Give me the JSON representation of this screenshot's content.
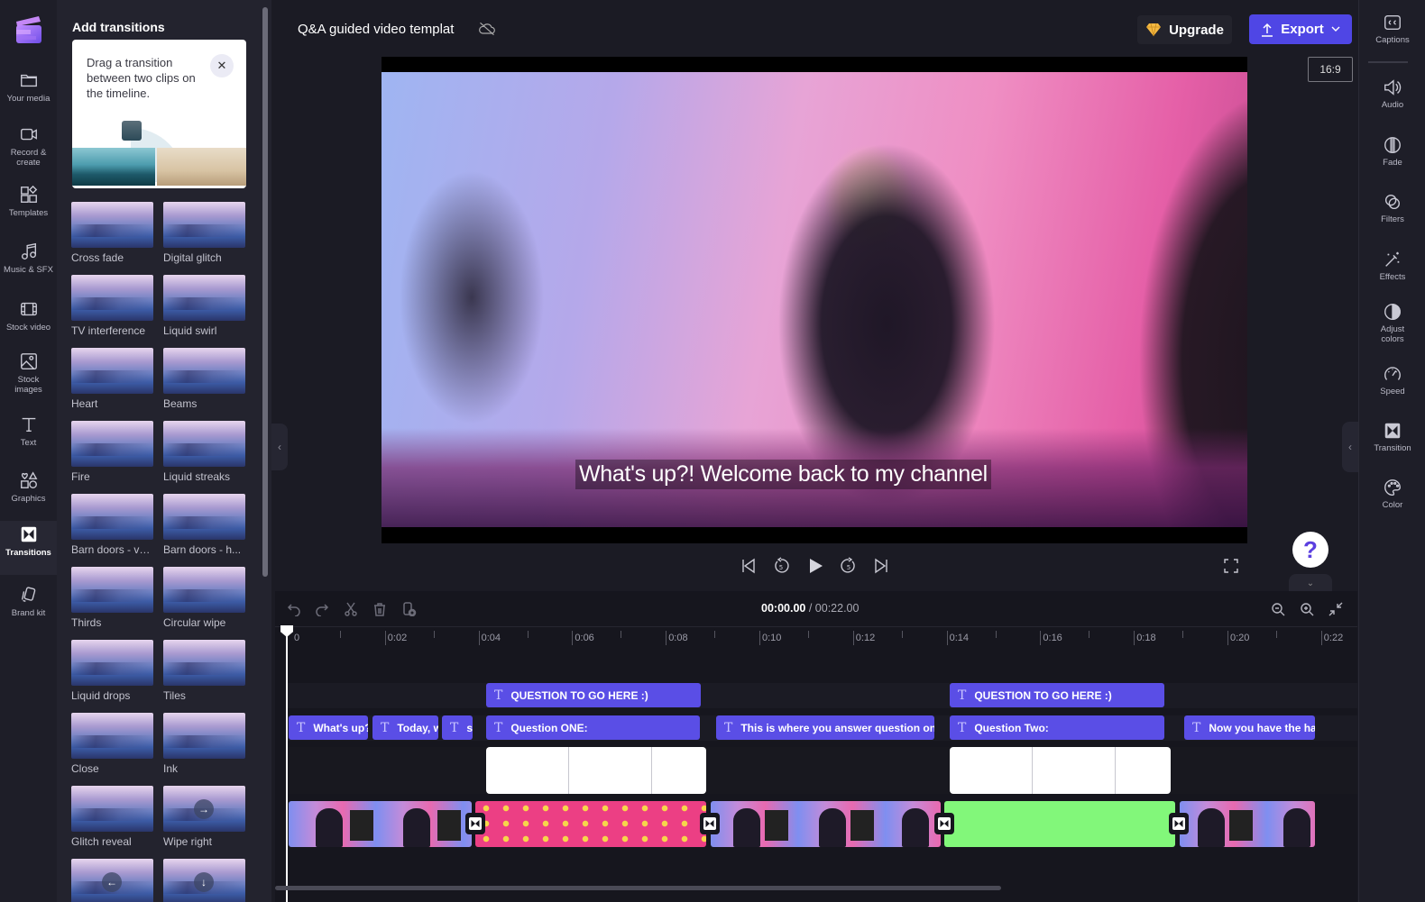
{
  "app": {
    "project_title": "Q&A guided video templat",
    "cloud_status_icon": "cloud-off-icon",
    "upgrade_label": "Upgrade",
    "export_label": "Export",
    "aspect_ratio": "16:9",
    "accent_color": "#4f46e5",
    "upgrade_icon_color": "#f5b942"
  },
  "left_rail": {
    "items": [
      {
        "id": "your-media",
        "label": "Your media",
        "icon": "folder-icon"
      },
      {
        "id": "record-create",
        "label": "Record & create",
        "icon": "video-camera-icon"
      },
      {
        "id": "templates",
        "label": "Templates",
        "icon": "templates-icon"
      },
      {
        "id": "music-sfx",
        "label": "Music & SFX",
        "icon": "music-note-icon"
      },
      {
        "id": "stock-video",
        "label": "Stock video",
        "icon": "film-icon"
      },
      {
        "id": "stock-images",
        "label": "Stock images",
        "icon": "image-icon"
      },
      {
        "id": "text",
        "label": "Text",
        "icon": "text-icon"
      },
      {
        "id": "graphics",
        "label": "Graphics",
        "icon": "shapes-icon"
      },
      {
        "id": "transitions",
        "label": "Transitions",
        "icon": "transition-icon",
        "active": true
      },
      {
        "id": "brand-kit",
        "label": "Brand kit",
        "icon": "brand-kit-icon"
      }
    ]
  },
  "transitions_panel": {
    "title": "Add transitions",
    "tip_text": "Drag a transition between two clips on the timeline.",
    "items": [
      {
        "name": "Cross fade"
      },
      {
        "name": "Digital glitch"
      },
      {
        "name": "TV interference"
      },
      {
        "name": "Liquid swirl"
      },
      {
        "name": "Heart"
      },
      {
        "name": "Beams"
      },
      {
        "name": "Fire"
      },
      {
        "name": "Liquid streaks"
      },
      {
        "name": "Barn doors - ve..."
      },
      {
        "name": "Barn doors - h..."
      },
      {
        "name": "Thirds"
      },
      {
        "name": "Circular wipe"
      },
      {
        "name": "Liquid drops"
      },
      {
        "name": "Tiles"
      },
      {
        "name": "Close"
      },
      {
        "name": "Ink"
      },
      {
        "name": "Glitch reveal"
      },
      {
        "name": "Wipe right",
        "arrow": "→"
      },
      {
        "name": "",
        "arrow": "←"
      },
      {
        "name": "",
        "arrow": "↓"
      }
    ]
  },
  "preview": {
    "caption": "What's up?! Welcome back to my channel"
  },
  "player": {
    "current_time": "00:00.00",
    "total_time": "/ 00:22.00",
    "skip_back_seconds": "5",
    "skip_forward_seconds": "5"
  },
  "right_rail": {
    "items": [
      {
        "id": "captions",
        "label": "Captions",
        "icon": "captions-icon"
      },
      {
        "id": "audio",
        "label": "Audio",
        "icon": "speaker-icon"
      },
      {
        "id": "fade",
        "label": "Fade",
        "icon": "fade-icon"
      },
      {
        "id": "filters",
        "label": "Filters",
        "icon": "filters-icon"
      },
      {
        "id": "effects",
        "label": "Effects",
        "icon": "magic-wand-icon"
      },
      {
        "id": "adjust-colors",
        "label": "Adjust colors",
        "icon": "contrast-icon"
      },
      {
        "id": "speed",
        "label": "Speed",
        "icon": "speedometer-icon"
      },
      {
        "id": "transition",
        "label": "Transition",
        "icon": "transition-icon"
      },
      {
        "id": "color",
        "label": "Color",
        "icon": "palette-icon"
      }
    ]
  },
  "timeline": {
    "ruler_labels": [
      "0",
      "0:02",
      "0:04",
      "0:06",
      "0:08",
      "0:10",
      "0:12",
      "0:14",
      "0:16",
      "0:18",
      "0:20",
      "0:22"
    ],
    "text_track_1": [
      {
        "label": "QUESTION TO GO HERE :)"
      },
      {
        "label": "QUESTION TO GO HERE :)"
      }
    ],
    "text_track_2": [
      {
        "label": "What's up?"
      },
      {
        "label": "Today, w"
      },
      {
        "label": "s"
      },
      {
        "label": "Question ONE:"
      },
      {
        "label": "This is where you answer question one"
      },
      {
        "label": "Question Two:"
      },
      {
        "label": "Now you have the ha"
      }
    ],
    "clip_colors": {
      "text_clip": "#5a4ee6",
      "pink_background": "#ec3f84",
      "green_background": "#82f77a"
    }
  }
}
